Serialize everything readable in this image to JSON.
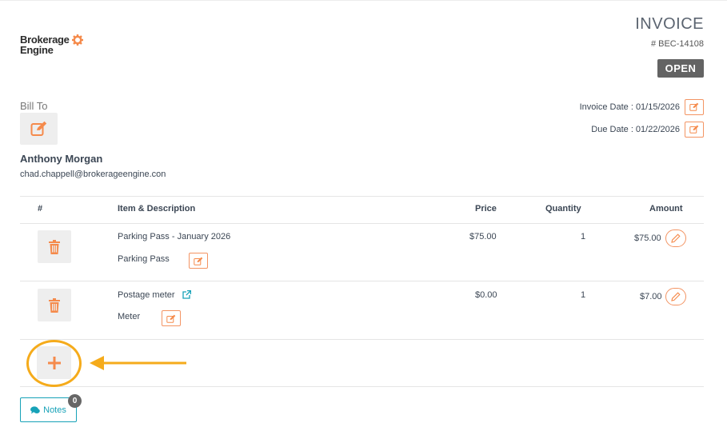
{
  "brand": {
    "logo_line1": "Brokerage",
    "logo_line2": "Engine",
    "accent_color": "#f58a4b"
  },
  "invoice": {
    "title": "INVOICE",
    "number": "# BEC-14108",
    "status": "OPEN",
    "invoice_date": "Invoice Date : 01/15/2026",
    "due_date": "Due Date : 01/22/2026"
  },
  "bill_to": {
    "label": "Bill To",
    "name": "Anthony Morgan",
    "email": "chad.chappell@brokerageengine.con"
  },
  "table": {
    "headers": {
      "num": "#",
      "item": "Item & Description",
      "price": "Price",
      "quantity": "Quantity",
      "amount": "Amount"
    },
    "rows": [
      {
        "item": "Parking Pass - January 2026",
        "description": "Parking Pass",
        "price": "$75.00",
        "quantity": "1",
        "amount": "$75.00",
        "external_link": false
      },
      {
        "item": "Postage meter",
        "description": "Meter",
        "price": "$0.00",
        "quantity": "1",
        "amount": "$7.00",
        "external_link": true
      }
    ]
  },
  "notes": {
    "label": "Notes",
    "count": "0",
    "color": "#17a2b8"
  },
  "annotation": {
    "highlight_color": "#f5ab1b"
  }
}
